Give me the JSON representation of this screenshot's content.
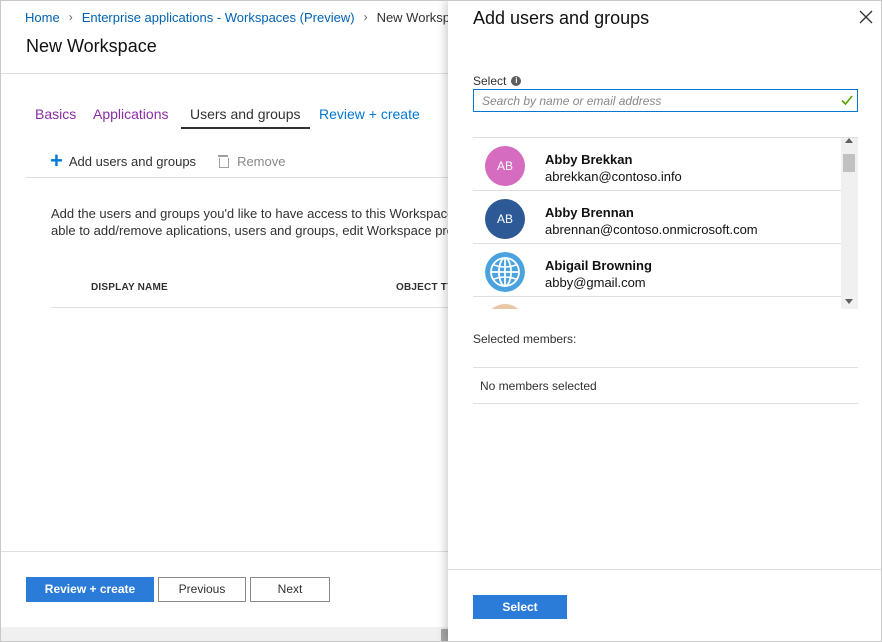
{
  "breadcrumb": {
    "items": [
      "Home",
      "Enterprise applications - Workspaces (Preview)",
      "New Workspace"
    ]
  },
  "page": {
    "title": "New Workspace"
  },
  "tabs": [
    "Basics",
    "Applications",
    "Users and groups",
    "Review + create"
  ],
  "commands": {
    "add": "Add users and groups",
    "remove": "Remove"
  },
  "description": {
    "line1": "Add the users and groups you'd like to have access to this Workspace",
    "line2": "able to add/remove aplications, users and groups, edit Workspace pro"
  },
  "grid": {
    "col_display_name": "DISPLAY NAME",
    "col_object_type": "OBJECT TYPE"
  },
  "footer": {
    "review_create": "Review + create",
    "previous": "Previous",
    "next": "Next"
  },
  "panel": {
    "title": "Add users and groups",
    "select_label": "Select",
    "search_placeholder": "Search by name or email address",
    "results": [
      {
        "initials": "AB",
        "name": "Abby Brekkan",
        "email": "abrekkan@contoso.info",
        "avatar_color": "#d56cc0"
      },
      {
        "initials": "AB",
        "name": "Abby Brennan",
        "email": "abrennan@contoso.onmicrosoft.com",
        "avatar_color": "#2d5a97"
      },
      {
        "initials": "",
        "name": "Abigail Browning",
        "email": "abby@gmail.com",
        "avatar_icon": "globe-icon",
        "avatar_color": "#4aa3df"
      }
    ],
    "selected_members_label": "Selected members:",
    "no_members": "No members selected",
    "select_button": "Select"
  },
  "colors": {
    "accent": "#0078d4",
    "primary_button": "#2b7bd8",
    "visited_tab": "#8a2da5",
    "valid_check": "#57a300"
  }
}
